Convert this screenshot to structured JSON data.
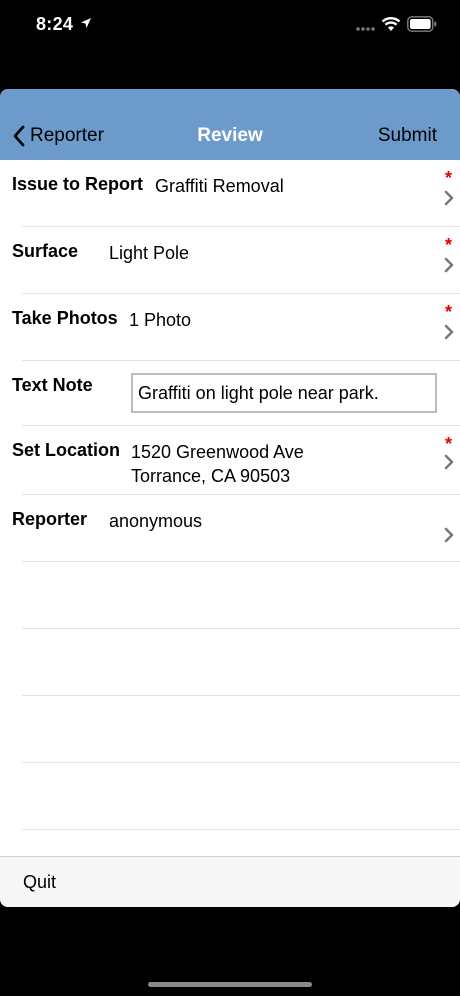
{
  "status_bar": {
    "time": "8:24"
  },
  "nav": {
    "back_label": "Reporter",
    "title": "Review",
    "submit_label": "Submit"
  },
  "rows": [
    {
      "label": "Issue to Report",
      "value": "Graffiti Removal",
      "required_mark": "*"
    },
    {
      "label": "Surface",
      "value": "Light Pole",
      "required_mark": "*"
    },
    {
      "label": "Take Photos",
      "value": "1 Photo",
      "required_mark": "*"
    },
    {
      "label": "Text Note",
      "value": "Graffiti on light pole near park."
    },
    {
      "label": "Set Location",
      "value_line1": "1520 Greenwood Ave",
      "value_line2": "Torrance, CA 90503",
      "required_mark": "*"
    },
    {
      "label": "Reporter",
      "value": "anonymous"
    }
  ],
  "toolbar": {
    "quit_label": "Quit"
  },
  "colors": {
    "nav_background": "#6c9bcb",
    "required_red": "#e00000"
  }
}
